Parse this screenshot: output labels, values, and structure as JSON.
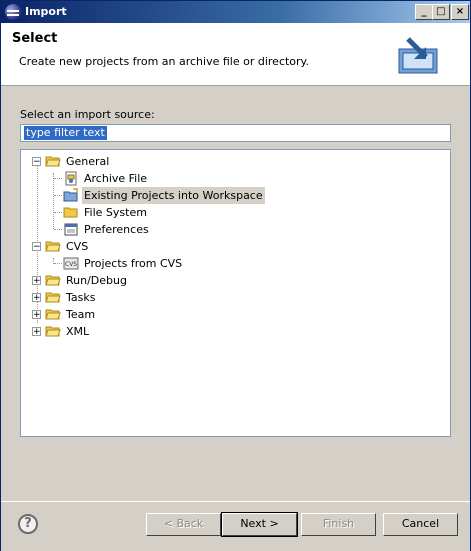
{
  "window": {
    "title": "Import"
  },
  "header": {
    "title": "Select",
    "description": "Create new projects from an archive file or directory."
  },
  "main": {
    "source_label": "Select an import source:",
    "filter_value": "type filter text"
  },
  "tree": {
    "general": "General",
    "archive_file": "Archive File",
    "existing_projects": "Existing Projects into Workspace",
    "file_system": "File System",
    "preferences": "Preferences",
    "cvs": "CVS",
    "projects_from_cvs": "Projects from CVS",
    "run_debug": "Run/Debug",
    "tasks": "Tasks",
    "team": "Team",
    "xml": "XML",
    "expanded_symbol": "−",
    "collapsed_symbol": "+"
  },
  "buttons": {
    "back": "< Back",
    "next": "Next >",
    "finish": "Finish",
    "cancel": "Cancel",
    "help": "?"
  },
  "colors": {
    "titlebar": "#0a246a",
    "selection": "#316ac5",
    "folder": "#f4c844"
  }
}
